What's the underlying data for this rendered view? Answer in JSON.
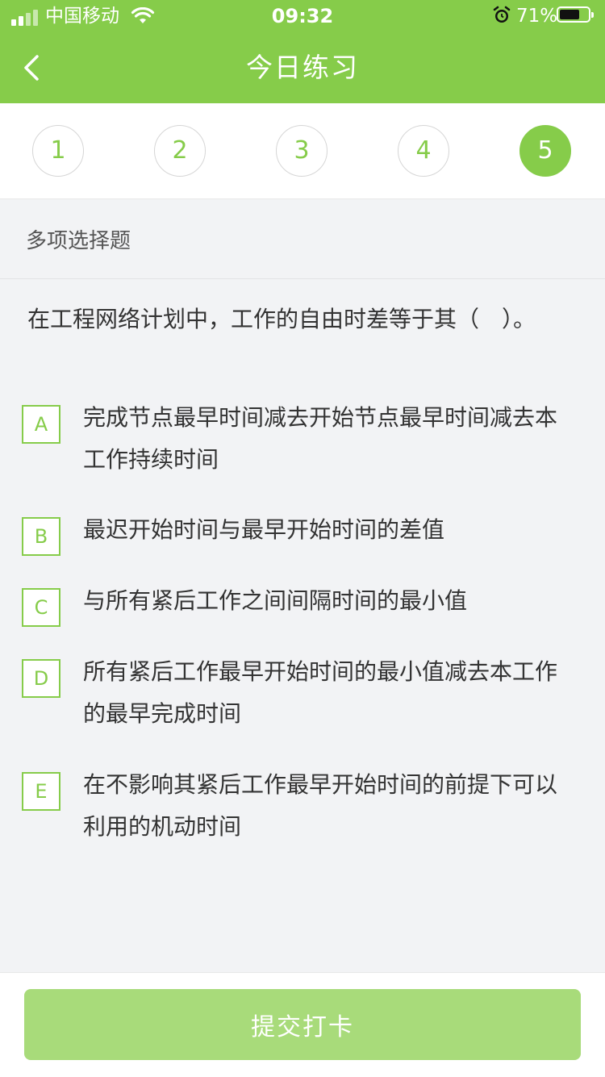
{
  "status_bar": {
    "carrier": "中国移动",
    "time": "09:32",
    "battery_percent": "71%",
    "battery_level": 0.71,
    "icons": [
      "signal-icon",
      "wifi-icon",
      "alarm-icon",
      "battery-icon"
    ]
  },
  "nav": {
    "title": "今日练习",
    "back_icon": "chevron-left-icon"
  },
  "question_tabs": [
    {
      "label": "1",
      "active": false
    },
    {
      "label": "2",
      "active": false
    },
    {
      "label": "3",
      "active": false
    },
    {
      "label": "4",
      "active": false
    },
    {
      "label": "5",
      "active": true
    }
  ],
  "question": {
    "type": "多项选择题",
    "stem": "在工程网络计划中，工作的自由时差等于其（　）。",
    "options": [
      {
        "letter": "A",
        "text": "完成节点最早时间减去开始节点最早时间减去本工作持续时间"
      },
      {
        "letter": "B",
        "text": "最迟开始时间与最早开始时间的差值"
      },
      {
        "letter": "C",
        "text": "与所有紧后工作之间间隔时间的最小值"
      },
      {
        "letter": "D",
        "text": "所有紧后工作最早开始时间的最小值减去本工作的最早完成时间"
      },
      {
        "letter": "E",
        "text": "在不影响其紧后工作最早开始时间的前提下可以利用的机动时间"
      }
    ]
  },
  "footer": {
    "submit_label": "提交打卡"
  },
  "colors": {
    "brand_green": "#86cc4a",
    "submit_disabled": "#a8db7a",
    "background": "#f2f3f5"
  }
}
